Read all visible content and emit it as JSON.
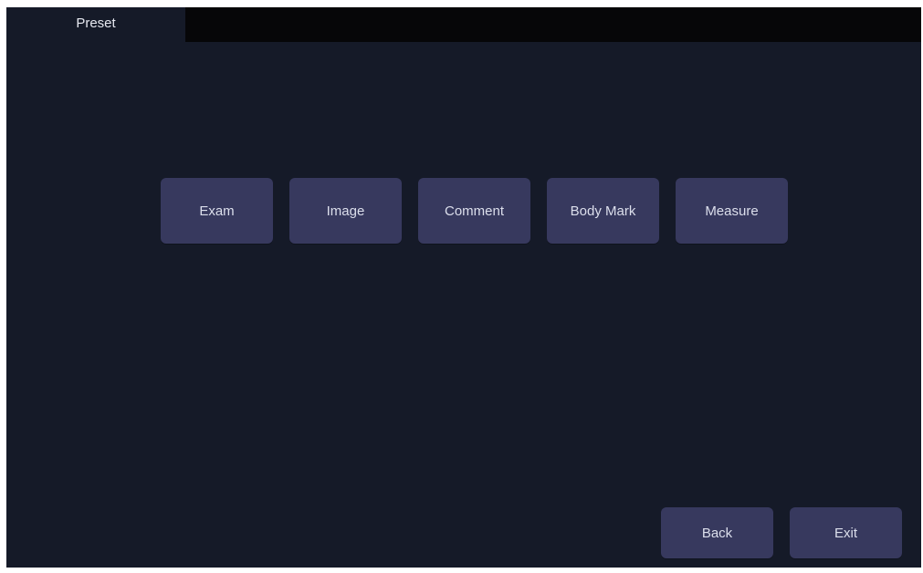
{
  "tabs": [
    {
      "label": "Preset"
    }
  ],
  "menu_buttons": [
    {
      "label": "Exam"
    },
    {
      "label": "Image"
    },
    {
      "label": "Comment"
    },
    {
      "label": "Body Mark"
    },
    {
      "label": "Measure"
    }
  ],
  "footer": {
    "back_label": "Back",
    "exit_label": "Exit"
  },
  "colors": {
    "background": "#151a28",
    "tab_bar": "#060608",
    "button": "#37395e",
    "text": "#dcdfec"
  }
}
